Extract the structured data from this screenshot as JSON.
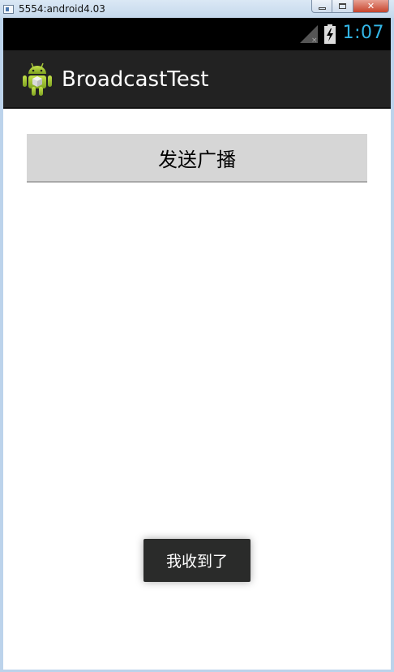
{
  "window": {
    "title": "5554:android4.03",
    "close_label": "✕"
  },
  "statusbar": {
    "time": "1:07",
    "icons": [
      "signal-no-service-icon",
      "battery-charging-icon"
    ],
    "time_color": "#33b5e5"
  },
  "actionbar": {
    "app_icon": "android-robot-icon",
    "title": "BroadcastTest"
  },
  "main": {
    "send_button_label": "发送广播"
  },
  "toast": {
    "message": "我收到了"
  }
}
